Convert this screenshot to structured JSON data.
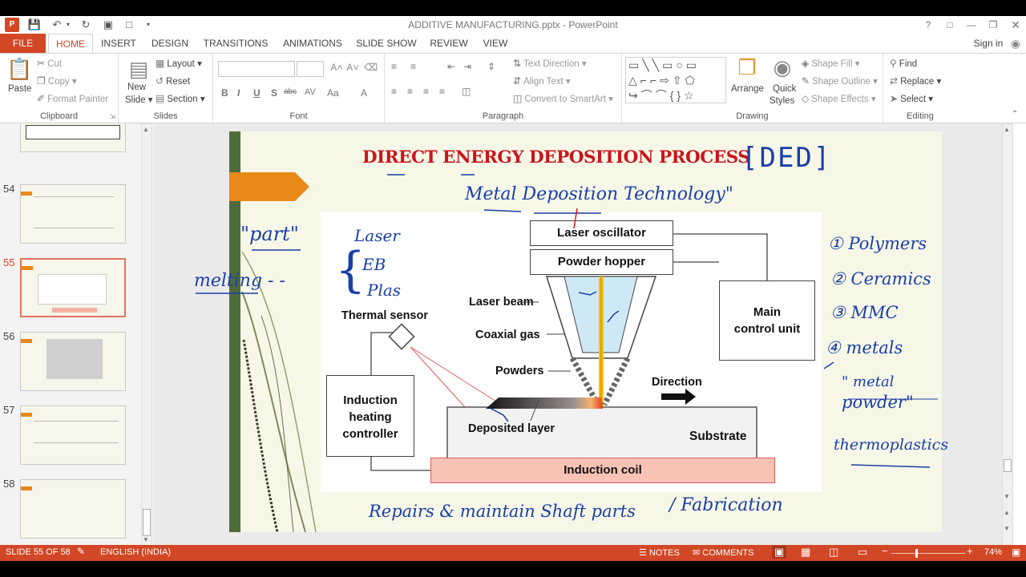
{
  "window": {
    "title": "ADDITIVE MANUFACTURING.pptx - PowerPoint",
    "help": "?",
    "signin": "Sign in"
  },
  "tabs": [
    "FILE",
    "HOME",
    "INSERT",
    "DESIGN",
    "TRANSITIONS",
    "ANIMATIONS",
    "SLIDE SHOW",
    "REVIEW",
    "VIEW"
  ],
  "ribbon": {
    "clipboard": {
      "label": "Clipboard",
      "paste": "Paste",
      "cut": "Cut",
      "copy": "Copy",
      "format_painter": "Format Painter"
    },
    "slides": {
      "label": "Slides",
      "new_slide_1": "New",
      "new_slide_2": "Slide",
      "layout": "Layout",
      "reset": "Reset",
      "section": "Section"
    },
    "font": {
      "label": "Font",
      "bold": "B",
      "italic": "I",
      "underline": "U",
      "shadow": "S",
      "strike": "abc",
      "spacing": "AV",
      "case": "Aa",
      "color": "A"
    },
    "paragraph": {
      "label": "Paragraph",
      "text_direction": "Text Direction",
      "align_text": "Align Text",
      "convert": "Convert to SmartArt"
    },
    "drawing": {
      "label": "Drawing",
      "arrange": "Arrange",
      "quick_styles_1": "Quick",
      "quick_styles_2": "Styles",
      "shape_fill": "Shape Fill",
      "shape_outline": "Shape Outline",
      "shape_effects": "Shape Effects"
    },
    "editing": {
      "label": "Editing",
      "find": "Find",
      "replace": "Replace",
      "select": "Select"
    }
  },
  "thumbnails": [
    {
      "num": "54"
    },
    {
      "num": "55"
    },
    {
      "num": "56"
    },
    {
      "num": "57"
    },
    {
      "num": "58"
    }
  ],
  "slide": {
    "title": "DIRECT ENERGY DEPOSITION PROCESS",
    "diagram": {
      "laser_oscillator": "Laser oscillator",
      "powder_hopper": "Powder hopper",
      "laser_beam": "Laser beam",
      "coaxial_gas": "Coaxial gas",
      "powders": "Powders",
      "thermal_sensor": "Thermal sensor",
      "main_control_1": "Main",
      "main_control_2": "control unit",
      "induction_ctrl_1": "Induction",
      "induction_ctrl_2": "heating",
      "induction_ctrl_3": "controller",
      "direction": "Direction",
      "deposited_layer": "Deposited layer",
      "substrate": "Substrate",
      "induction_coil": "Induction coil"
    },
    "annotations": {
      "ded": "[DED]",
      "metal_dep": "Metal Deposition Technology\"",
      "part": "\"part\"",
      "melting": "melting - -",
      "laser": "Laser",
      "eb": "EB",
      "plas": "Plas",
      "polymers": "① Polymers",
      "ceramics": "② Ceramics",
      "mmc": "③ MMC",
      "metals": "④ metals",
      "metal_powder_1": "\" metal",
      "metal_powder_2": "powder\"",
      "thermoplastics": "thermoplastics",
      "repairs": "Repairs & maintain Shaft parts",
      "fabrication": "/ Fabrication"
    }
  },
  "statusbar": {
    "slide_info": "SLIDE 55 OF 58",
    "language": "ENGLISH (INDIA)",
    "notes": "NOTES",
    "comments": "COMMENTS",
    "zoom": "74%"
  },
  "colors": {
    "accent": "#d24726",
    "ink": "#1a3fa6",
    "title_red": "#c8161d",
    "slide_bg": "#f7f7e8",
    "orange_tab": "#e8891a"
  }
}
